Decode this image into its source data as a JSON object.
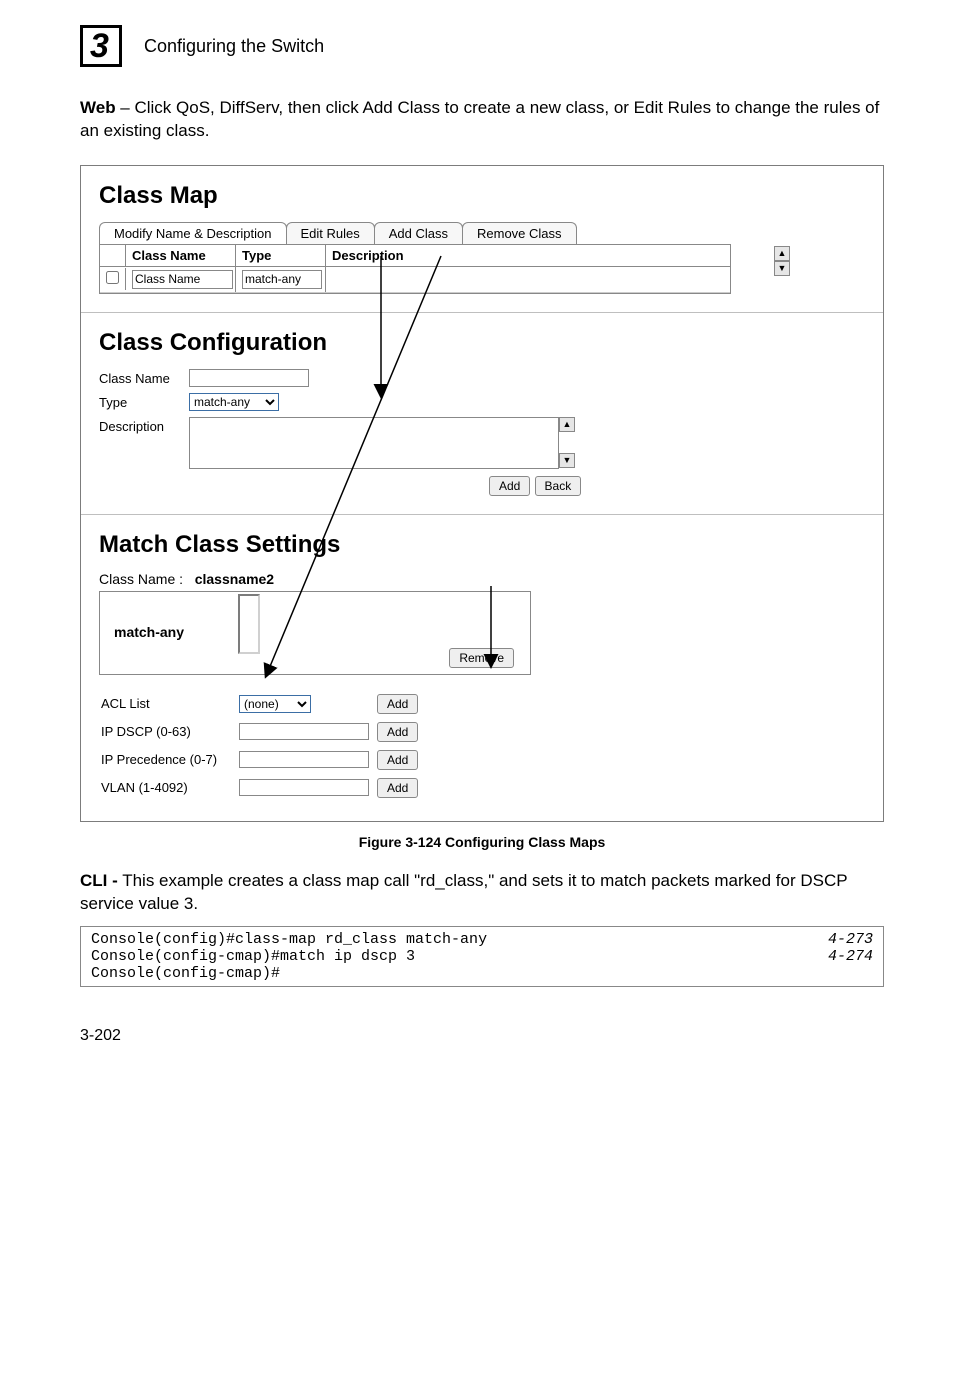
{
  "header": {
    "chapter_number": "3",
    "title": "Configuring the Switch"
  },
  "intro": {
    "bold": "Web",
    "text": " – Click QoS, DiffServ, then click Add Class to create a new class, or Edit Rules to change the rules of an existing class."
  },
  "class_map": {
    "title": "Class Map",
    "tabs": {
      "modify": "Modify Name & Description",
      "edit_rules": "Edit Rules",
      "add_class": "Add Class",
      "remove_class": "Remove Class"
    },
    "columns": {
      "class_name": "Class Name",
      "type": "Type",
      "description": "Description"
    },
    "row": {
      "class_name_value": "Class Name",
      "type_value": "match-any"
    }
  },
  "class_config": {
    "title": "Class Configuration",
    "labels": {
      "class_name": "Class Name",
      "type": "Type",
      "description": "Description"
    },
    "type_value": "match-any",
    "buttons": {
      "add": "Add",
      "back": "Back"
    }
  },
  "match_settings": {
    "title": "Match Class Settings",
    "class_name_label": "Class Name :",
    "class_name_value": "classname2",
    "match_any_label": "match-any",
    "remove_btn": "Remove",
    "rows": {
      "acl_list": "ACL List",
      "acl_value": "(none)",
      "ip_dscp": "IP DSCP (0-63)",
      "ip_prec": "IP Precedence (0-7)",
      "vlan": "VLAN (1-4092)"
    },
    "add_btn": "Add"
  },
  "figure_caption": "Figure 3-124  Configuring Class Maps",
  "cli": {
    "bold": "CLI -",
    "text": " This example creates a class map call \"rd_class,\" and sets it to match packets marked for DSCP service value 3.",
    "lines": [
      "Console(config)#class-map rd_class match-any",
      "Console(config-cmap)#match ip dscp 3",
      "Console(config-cmap)#"
    ],
    "refs": [
      "4-273",
      "4-274",
      ""
    ]
  },
  "page_number": "3-202"
}
